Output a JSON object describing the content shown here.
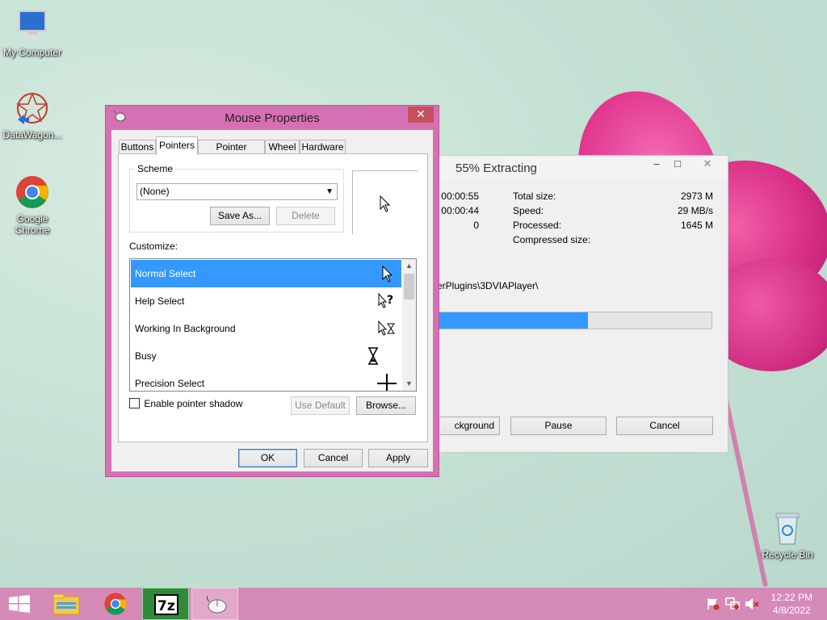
{
  "desktop": {
    "icons": [
      {
        "label": "My Computer"
      },
      {
        "label": "DataWagon..."
      },
      {
        "label": "Google Chrome"
      },
      {
        "label": "Recycle Bin"
      }
    ]
  },
  "extract_window": {
    "title": "55% Extracting",
    "elapsed_time": "00:00:55",
    "remaining_time": "00:00:44",
    "files": "0",
    "total_size_label": "Total size:",
    "total_size": "2973 M",
    "speed_label": "Speed:",
    "speed": "29 MB/s",
    "processed_label": "Processed:",
    "processed": "1645 M",
    "compressed_label": "Compressed size:",
    "current_path": "erPlugins\\3DVIAPlayer\\",
    "progress": 0.55,
    "background_button": "ckground",
    "pause_button": "Pause",
    "cancel_button": "Cancel"
  },
  "mouse_window": {
    "title": "Mouse Properties",
    "close_glyph": "✕",
    "tabs": [
      "Buttons",
      "Pointers",
      "Pointer Options",
      "Wheel",
      "Hardware"
    ],
    "active_tab": "Pointers",
    "scheme_label": "Scheme",
    "scheme_value": "(None)",
    "save_as_button": "Save As...",
    "delete_button": "Delete",
    "customize_label": "Customize:",
    "pointers": [
      {
        "name": "Normal Select",
        "icon": "arrow-cursor-icon"
      },
      {
        "name": "Help Select",
        "icon": "help-cursor-icon"
      },
      {
        "name": "Working In Background",
        "icon": "working-cursor-icon"
      },
      {
        "name": "Busy",
        "icon": "hourglass-icon"
      },
      {
        "name": "Precision Select",
        "icon": "crosshair-icon"
      }
    ],
    "enable_shadow_label": "Enable pointer shadow",
    "use_default_button": "Use Default",
    "browse_button": "Browse...",
    "ok_button": "OK",
    "cancel_button": "Cancel",
    "apply_button": "Apply"
  },
  "taskbar": {
    "time": "12:22 PM",
    "date": "4/8/2022"
  },
  "colors": {
    "selection": "#3399ff",
    "progress": "#3399ff",
    "mouse_frame": "#d770b3",
    "taskbar": "#d58ab8"
  }
}
